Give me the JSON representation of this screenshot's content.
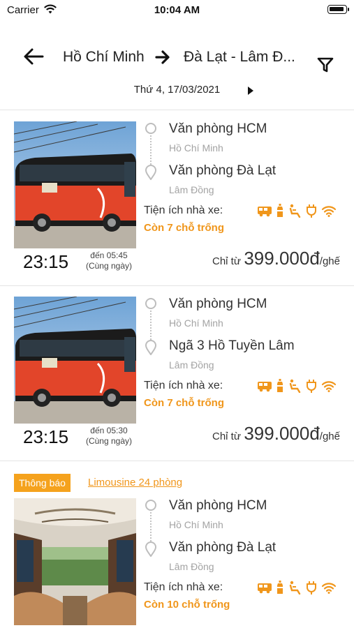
{
  "status_bar": {
    "carrier": "Carrier",
    "time": "10:04 AM"
  },
  "header": {
    "from": "Hồ Chí Minh",
    "to": "Đà Lạt - Lâm Đ...",
    "date": "Thứ 4, 17/03/2021"
  },
  "trips": [
    {
      "from_office": "Văn phòng HCM",
      "from_city": "Hồ Chí Minh",
      "to_office": "Văn phòng Đà Lạt",
      "to_city": "Lâm Đồng",
      "amenities_label": "Tiện ích nhà xe:",
      "seats": "Còn  7 chỗ trống",
      "depart": "23:15",
      "arrive": "đến  05:45",
      "arrive_note": "(Cùng ngày)",
      "price_prefix": "Chỉ từ",
      "price": "399.000đ",
      "price_unit": "/ghế"
    },
    {
      "from_office": "Văn phòng HCM",
      "from_city": "Hồ Chí Minh",
      "to_office": "Ngã 3 Hồ Tuyền Lâm",
      "to_city": "Lâm Đồng",
      "amenities_label": "Tiện ích nhà xe:",
      "seats": "Còn  7 chỗ trống",
      "depart": "23:15",
      "arrive": "đến  05:30",
      "arrive_note": "(Cùng ngày)",
      "price_prefix": "Chỉ từ",
      "price": "399.000đ",
      "price_unit": "/ghế"
    },
    {
      "notice_badge": "Thông báo",
      "notice_link": "Limousine 24 phòng",
      "from_office": "Văn phòng HCM",
      "from_city": "Hồ Chí Minh",
      "to_office": "Văn phòng Đà Lạt",
      "to_city": "Lâm Đồng",
      "amenities_label": "Tiện ích nhà xe:",
      "seats": "Còn  10 chỗ trống"
    }
  ],
  "amenity_icons": [
    "bus-icon",
    "water-bottle-icon",
    "reclining-seat-icon",
    "charger-plug-icon",
    "wifi-icon"
  ],
  "colors": {
    "accent": "#f0961b",
    "badge": "#f5a21d",
    "bus_red": "#e2452a"
  }
}
